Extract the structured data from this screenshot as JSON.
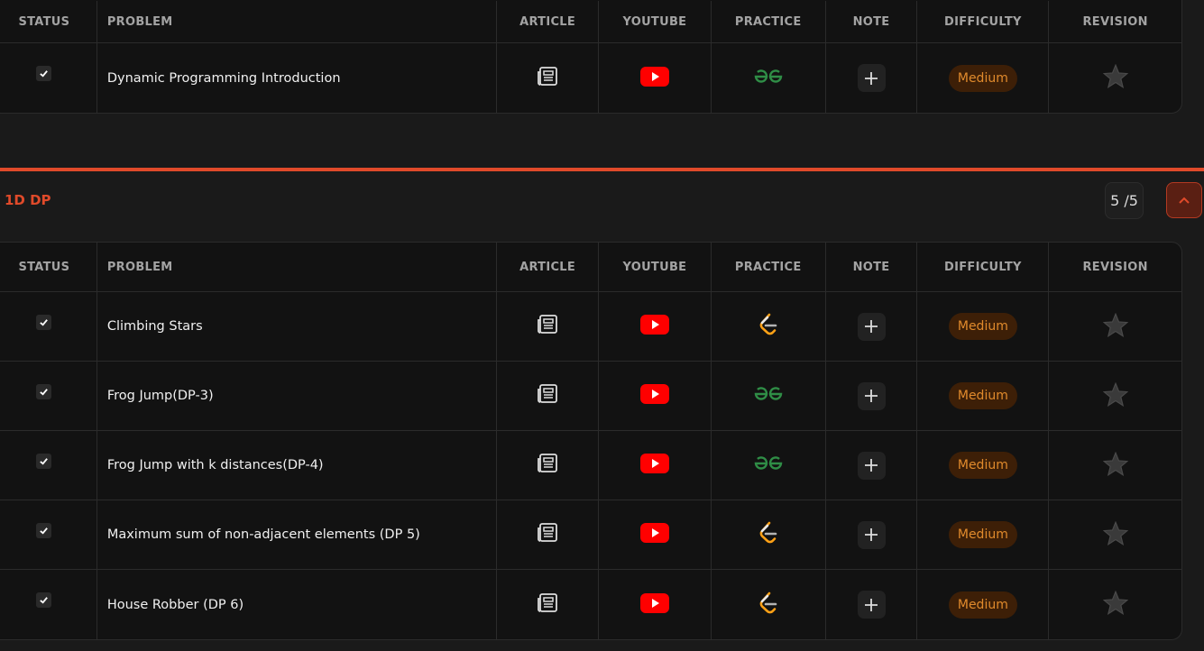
{
  "columns": {
    "status": "STATUS",
    "problem": "PROBLEM",
    "article": "ARTICLE",
    "youtube": "YOUTUBE",
    "practice": "PRACTICE",
    "note": "NOTE",
    "difficulty": "DIFFICULTY",
    "revision": "REVISION"
  },
  "section_top": {
    "rows": [
      {
        "problem": "Dynamic Programming Introduction",
        "difficulty": "Medium",
        "practice_icon": "gfg-icon",
        "done": true
      }
    ]
  },
  "section_1d": {
    "title": "1D DP",
    "count": "5 /5",
    "rows": [
      {
        "problem": "Climbing Stars",
        "difficulty": "Medium",
        "practice_icon": "leetcode-icon",
        "done": true
      },
      {
        "problem": "Frog Jump(DP-3)",
        "difficulty": "Medium",
        "practice_icon": "gfg-icon",
        "done": true
      },
      {
        "problem": "Frog Jump with k distances(DP-4)",
        "difficulty": "Medium",
        "practice_icon": "gfg-icon",
        "done": true
      },
      {
        "problem": "Maximum sum of non-adjacent elements (DP 5)",
        "difficulty": "Medium",
        "practice_icon": "leetcode-icon",
        "done": true
      },
      {
        "problem": "House Robber (DP 6)",
        "difficulty": "Medium",
        "practice_icon": "leetcode-icon",
        "done": true
      }
    ]
  },
  "colors": {
    "accent": "#e04a2a",
    "badge_bg": "#3d1f07",
    "badge_text": "#e08a2c",
    "youtube": "#ff0000",
    "gfg": "#2f8d46",
    "leetcode": "#ffa116"
  }
}
